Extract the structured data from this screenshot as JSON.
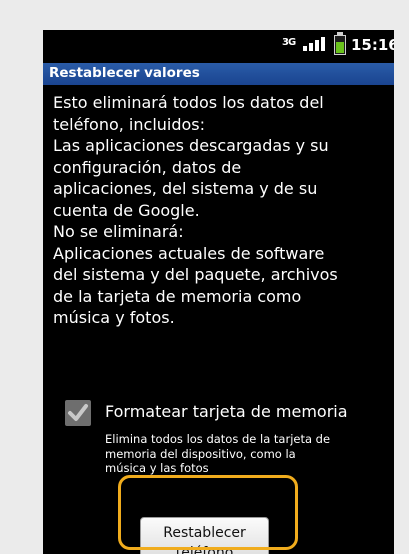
{
  "status_bar": {
    "network": "3G",
    "time": "15:16"
  },
  "dialog": {
    "title": "Restablecer valores",
    "body_lines": [
      "Esto eliminará todos los datos del",
      "teléfono, incluidos:",
      "Las aplicaciones descargadas y su",
      "configuración, datos de",
      "aplicaciones, del sistema y de su",
      "cuenta de Google.",
      "No se eliminará:",
      "Aplicaciones actuales de software",
      "del sistema y del paquete, archivos",
      "de la tarjeta de memoria como",
      "música y fotos."
    ],
    "checkbox": {
      "label": "Formatear tarjeta de memoria",
      "checked": true,
      "description_lines": [
        "Elimina todos los datos de la tarjeta de",
        "memoria del dispositivo, como la",
        "música y las fotos"
      ]
    },
    "reset_button": {
      "line1": "Restablecer",
      "line2": "teléfono"
    }
  },
  "colors": {
    "page_background": "#ebebeb",
    "screen_background": "#000000",
    "title_bar": "#1f4f9c",
    "highlight_border": "#f0ac1d",
    "battery_fill": "#6ac21c"
  }
}
